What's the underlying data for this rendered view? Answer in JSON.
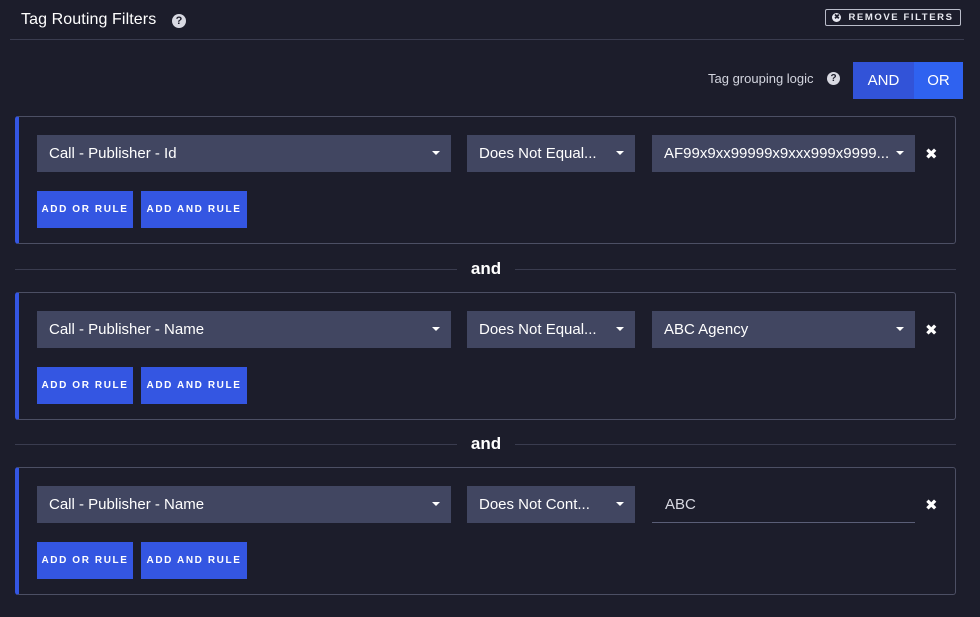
{
  "header": {
    "title": "Tag Routing Filters",
    "help_glyph": "?",
    "remove_label": "REMOVE FILTERS",
    "remove_glyph": "✖"
  },
  "grouping": {
    "label": "Tag grouping logic",
    "help_glyph": "?",
    "options": [
      "AND",
      "OR"
    ],
    "selected": "OR"
  },
  "connector_label": "and",
  "delete_glyph": "✖",
  "add_or_label": "ADD OR RULE",
  "add_and_label": "ADD AND RULE",
  "groups": [
    {
      "field": "Call - Publisher - Id",
      "operator": "Does Not Equal...",
      "value": "AF99x9xx99999x9xxx999x9999...",
      "value_type": "select"
    },
    {
      "field": "Call - Publisher - Name",
      "operator": "Does Not Equal...",
      "value": "ABC Agency",
      "value_type": "select"
    },
    {
      "field": "Call - Publisher - Name",
      "operator": "Does Not Cont...",
      "value": "ABC",
      "value_type": "text"
    }
  ],
  "colors": {
    "background": "#1c1d2b",
    "accent": "#3456e2",
    "select_bg": "#414661",
    "selected_toggle": "#2f62f0"
  }
}
